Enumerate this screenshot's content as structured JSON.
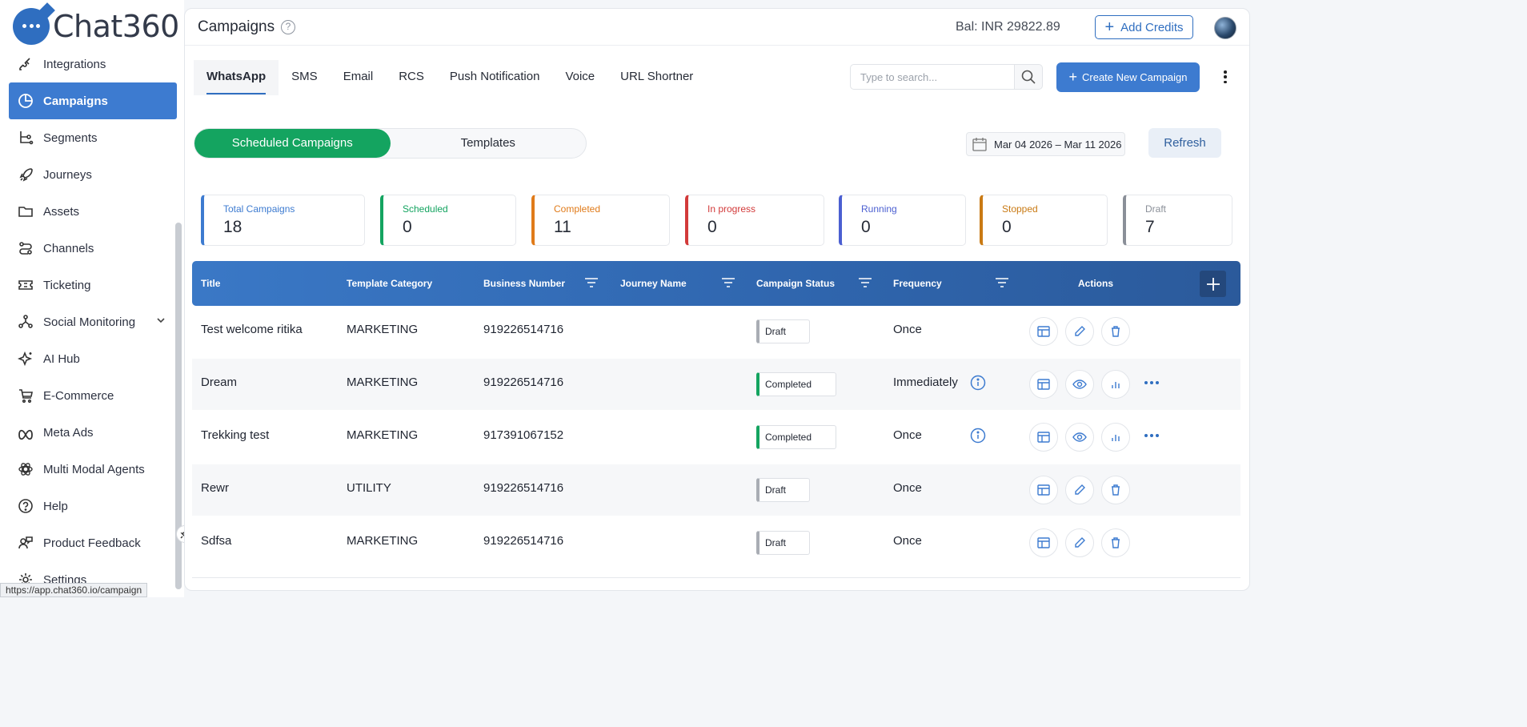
{
  "app": {
    "logo_text": "Chat360",
    "status_url": "https://app.chat360.io/campaign"
  },
  "sidebar": {
    "items": [
      {
        "label": "Integrations",
        "icon": "integrations-icon"
      },
      {
        "label": "Campaigns",
        "icon": "pie-chart-icon",
        "active": true
      },
      {
        "label": "Segments",
        "icon": "segments-icon"
      },
      {
        "label": "Journeys",
        "icon": "rocket-icon"
      },
      {
        "label": "Assets",
        "icon": "folder-icon"
      },
      {
        "label": "Channels",
        "icon": "channels-icon"
      },
      {
        "label": "Ticketing",
        "icon": "ticket-icon"
      },
      {
        "label": "Social Monitoring",
        "icon": "social-icon"
      },
      {
        "label": "AI Hub",
        "icon": "sparkle-icon"
      },
      {
        "label": "E-Commerce",
        "icon": "cart-icon"
      },
      {
        "label": "Meta Ads",
        "icon": "meta-icon"
      },
      {
        "label": "Multi Modal Agents",
        "icon": "agents-icon"
      },
      {
        "label": "Help",
        "icon": "help-icon"
      },
      {
        "label": "Product Feedback",
        "icon": "feedback-icon"
      },
      {
        "label": "Settings",
        "icon": "gear-icon"
      }
    ]
  },
  "header": {
    "title": "Campaigns",
    "help_glyph": "?",
    "balance": "Bal: INR 29822.89",
    "add_credits": "Add Credits"
  },
  "channel_tabs": [
    "WhatsApp",
    "SMS",
    "Email",
    "RCS",
    "Push Notification",
    "Voice",
    "URL Shortner"
  ],
  "search": {
    "placeholder": "Type to search..."
  },
  "create_button": "Create New Campaign",
  "view_toggle": {
    "options": [
      "Scheduled Campaigns",
      "Templates"
    ],
    "selected": "Scheduled Campaigns"
  },
  "date_range": "Mar 04 2026 – Mar 11 2026",
  "refresh_label": "Refresh",
  "stats": [
    {
      "label": "Total Campaigns",
      "value": "18",
      "color": "#3d7bd0"
    },
    {
      "label": "Scheduled",
      "value": "0",
      "color": "#14a460"
    },
    {
      "label": "Completed",
      "value": "11",
      "color": "#e07b1a"
    },
    {
      "label": "In progress",
      "value": "0",
      "color": "#d23a3a"
    },
    {
      "label": "Running",
      "value": "0",
      "color": "#4b5fd1"
    },
    {
      "label": "Stopped",
      "value": "0",
      "color": "#c97a14"
    },
    {
      "label": "Draft",
      "value": "7",
      "color": "#8a8f98"
    }
  ],
  "table": {
    "columns": [
      "Title",
      "Template Category",
      "Business Number",
      "Journey Name",
      "Campaign Status",
      "Frequency",
      "Actions"
    ],
    "rows": [
      {
        "title": "Test welcome ritika",
        "category": "MARKETING",
        "number": "919226514716",
        "journey": "",
        "status": "Draft",
        "frequency": "Once"
      },
      {
        "title": "Dream",
        "category": "MARKETING",
        "number": "919226514716",
        "journey": "",
        "status": "Completed",
        "frequency": "Immediately"
      },
      {
        "title": "Trekking test",
        "category": "MARKETING",
        "number": "917391067152",
        "journey": "",
        "status": "Completed",
        "frequency": "Once"
      },
      {
        "title": "Rewr",
        "category": "UTILITY",
        "number": "919226514716",
        "journey": "",
        "status": "Draft",
        "frequency": "Once"
      },
      {
        "title": "Sdfsa",
        "category": "MARKETING",
        "number": "919226514716",
        "journey": "",
        "status": "Draft",
        "frequency": "Once"
      }
    ]
  },
  "colors": {
    "accent": "#3d7bd0",
    "success": "#14a460",
    "draft": "#a9adb4"
  }
}
